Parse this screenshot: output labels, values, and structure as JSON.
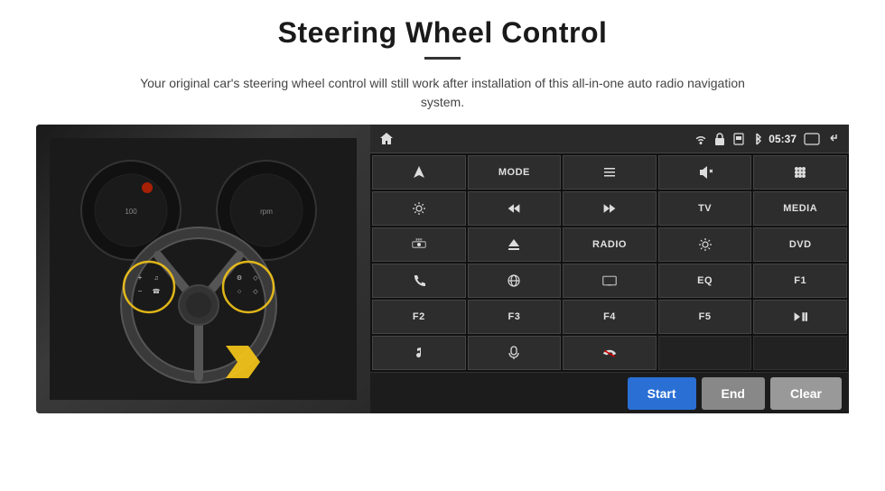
{
  "page": {
    "title": "Steering Wheel Control",
    "subtitle": "Your original car's steering wheel control will still work after installation of this all-in-one auto radio navigation system."
  },
  "status_bar": {
    "time": "05:37"
  },
  "buttons": [
    {
      "id": "nav",
      "type": "icon",
      "icon": "navigate",
      "label": ""
    },
    {
      "id": "mode",
      "type": "text",
      "label": "MODE"
    },
    {
      "id": "list",
      "type": "icon",
      "icon": "list",
      "label": ""
    },
    {
      "id": "mute",
      "type": "icon",
      "icon": "mute",
      "label": ""
    },
    {
      "id": "apps",
      "type": "icon",
      "icon": "apps",
      "label": ""
    },
    {
      "id": "settings",
      "type": "icon",
      "icon": "settings",
      "label": ""
    },
    {
      "id": "prev",
      "type": "icon",
      "icon": "prev",
      "label": ""
    },
    {
      "id": "next",
      "type": "icon",
      "icon": "next",
      "label": ""
    },
    {
      "id": "tv",
      "type": "text",
      "label": "TV"
    },
    {
      "id": "media",
      "type": "text",
      "label": "MEDIA"
    },
    {
      "id": "360",
      "type": "icon",
      "icon": "360",
      "label": ""
    },
    {
      "id": "eject",
      "type": "icon",
      "icon": "eject",
      "label": ""
    },
    {
      "id": "radio",
      "type": "text",
      "label": "RADIO"
    },
    {
      "id": "brightness",
      "type": "icon",
      "icon": "brightness",
      "label": ""
    },
    {
      "id": "dvd",
      "type": "text",
      "label": "DVD"
    },
    {
      "id": "phone",
      "type": "icon",
      "icon": "phone",
      "label": ""
    },
    {
      "id": "wifi",
      "type": "icon",
      "icon": "wifi",
      "label": ""
    },
    {
      "id": "screen",
      "type": "icon",
      "icon": "screen",
      "label": ""
    },
    {
      "id": "eq",
      "type": "text",
      "label": "EQ"
    },
    {
      "id": "f1",
      "type": "text",
      "label": "F1"
    },
    {
      "id": "f2",
      "type": "text",
      "label": "F2"
    },
    {
      "id": "f3",
      "type": "text",
      "label": "F3"
    },
    {
      "id": "f4",
      "type": "text",
      "label": "F4"
    },
    {
      "id": "f5",
      "type": "text",
      "label": "F5"
    },
    {
      "id": "playpause",
      "type": "icon",
      "icon": "playpause",
      "label": ""
    },
    {
      "id": "music",
      "type": "icon",
      "icon": "music",
      "label": ""
    },
    {
      "id": "mic",
      "type": "icon",
      "icon": "mic",
      "label": ""
    },
    {
      "id": "callend",
      "type": "icon",
      "icon": "callend",
      "label": ""
    },
    {
      "id": "empty1",
      "type": "empty",
      "label": ""
    },
    {
      "id": "empty2",
      "type": "empty",
      "label": ""
    }
  ],
  "bottom_buttons": {
    "start_label": "Start",
    "end_label": "End",
    "clear_label": "Clear"
  }
}
